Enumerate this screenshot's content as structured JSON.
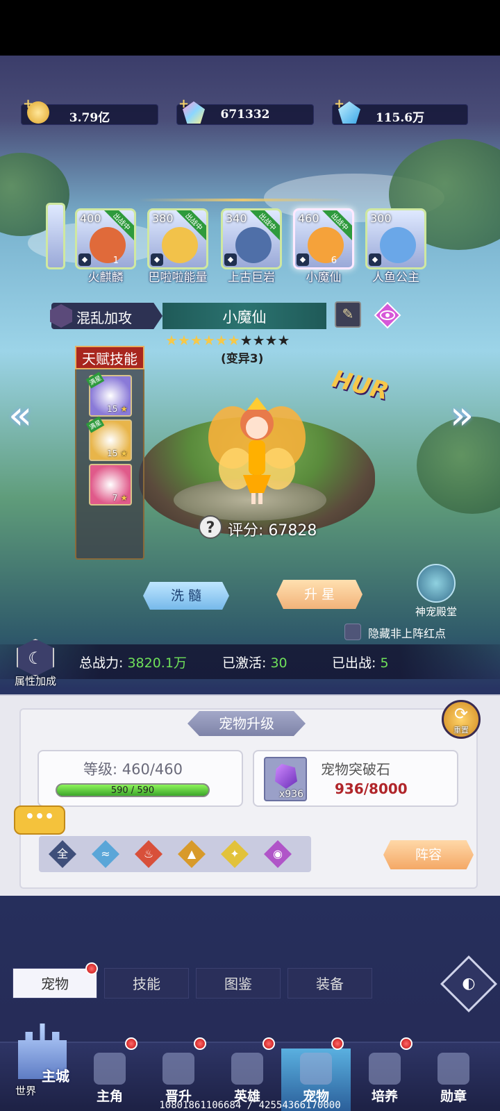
{
  "currency": {
    "gold": "3.79亿",
    "crystal": "671332",
    "diamond": "115.6万"
  },
  "pets": [
    {
      "level": "400",
      "name": "火麒麟",
      "tag": "出战中",
      "extra": "1",
      "color": "#e06a3a",
      "element": "fire"
    },
    {
      "level": "380",
      "name": "巴啦啦能量",
      "tag": "出战中",
      "extra": "",
      "color": "#f2c24a",
      "element": "wind"
    },
    {
      "level": "340",
      "name": "上古巨岩",
      "tag": "出战中",
      "extra": "",
      "color": "#4f6fa8",
      "element": "water"
    },
    {
      "level": "460",
      "name": "小魔仙",
      "tag": "出战中",
      "extra": "6",
      "color": "#f5a23a",
      "element": "chaos"
    },
    {
      "level": "300",
      "name": "人鱼公主",
      "tag": "",
      "extra": "",
      "color": "#6aa7e8",
      "element": "wind"
    }
  ],
  "selected": {
    "skill_label": "混乱加攻",
    "name": "小魔仙",
    "stars_on": 6,
    "stars_total": 10,
    "variant": "(变异3)",
    "score": "评分: 67828"
  },
  "talent": {
    "title": "天赋技能",
    "skills": [
      {
        "num": "15",
        "badge": "满星",
        "color": "#8a7ad8"
      },
      {
        "num": "15",
        "badge": "满星",
        "color": "#e8b54a"
      },
      {
        "num": "7",
        "badge": "",
        "color": "#e05a8a"
      }
    ]
  },
  "hur_text": "HUR",
  "actions": {
    "wash": "洗 髓",
    "star_up": "升 星",
    "hall": "神宠殿堂",
    "hide_red": "隐藏非上阵红点",
    "attr_bonus": "属性加成"
  },
  "stats": {
    "power_label": "总战力:",
    "power_value": "3820.1万",
    "activated_label": "已激活:",
    "activated_value": "30",
    "deployed_label": "已出战:",
    "deployed_value": "5"
  },
  "upgrade": {
    "title": "宠物升级",
    "reset": "重置",
    "level_label": "等级: 460/460",
    "xp_text": "590 / 590",
    "xp_fraction": 1.0,
    "stone_name": "宠物突破石",
    "stone_count": "x936",
    "stone_qty": "936/8000",
    "lineup": "阵容",
    "chat": "•••"
  },
  "filters": [
    {
      "label": "全",
      "color": "#3f4f7a"
    },
    {
      "label": "≈",
      "color": "#5aa6d8"
    },
    {
      "label": "♨",
      "color": "#d8503a"
    },
    {
      "label": "▲",
      "color": "#d89a2a"
    },
    {
      "label": "✦",
      "color": "#e2c23a"
    },
    {
      "label": "◉",
      "color": "#b055c8"
    }
  ],
  "tabs": [
    "宠物",
    "技能",
    "图鉴",
    "装备"
  ],
  "nav": {
    "main_city": "主城",
    "world": "世界",
    "items": [
      "主角",
      "晋升",
      "英雄",
      "宠物",
      "培养",
      "勋章"
    ]
  },
  "footer_id": "10801861106684 / 42554366170000"
}
